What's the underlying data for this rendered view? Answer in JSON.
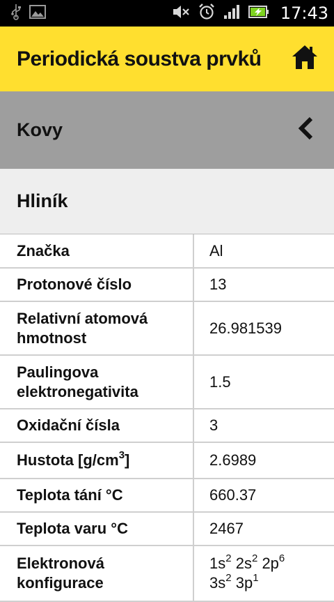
{
  "status_bar": {
    "time": "17:43",
    "icons": [
      "usb-icon",
      "gallery-icon",
      "mute-icon",
      "alarm-icon",
      "signal-icon",
      "battery-icon"
    ]
  },
  "app_bar": {
    "title": "Periodická soustva prvků",
    "home_icon": "home-icon"
  },
  "section": {
    "title": "Kovy",
    "back_icon": "chevron-left-icon"
  },
  "element": {
    "name": "Hliník"
  },
  "properties": {
    "symbol": {
      "label": "Značka",
      "value": "Al"
    },
    "proton_number": {
      "label": "Protonové číslo",
      "value": "13"
    },
    "atomic_mass": {
      "label": "Relativní atomová hmotnost",
      "value": "26.981539"
    },
    "electronegativity": {
      "label": "Paulingova elektronegativita",
      "value": "1.5"
    },
    "oxidation": {
      "label": "Oxidační čísla",
      "value": "3"
    },
    "density": {
      "label_main": "Hustota [g/cm",
      "label_sup": "3",
      "label_end": "]",
      "value": "2.6989"
    },
    "melting": {
      "label": "Teplota tání °C",
      "value": "660.37"
    },
    "boiling": {
      "label": "Teplota varu °C",
      "value": "2467"
    },
    "config": {
      "label": "Elektronová konfigurace",
      "orbitals": [
        {
          "base": "1s",
          "exp": "2"
        },
        {
          "base": "2s",
          "exp": "2"
        },
        {
          "base": "2p",
          "exp": "6"
        },
        {
          "base": "3s",
          "exp": "2"
        },
        {
          "base": "3p",
          "exp": "1"
        }
      ]
    }
  },
  "colors": {
    "app_bar": "#ffdf2f",
    "section": "#9e9e9e",
    "element_header": "#eeeeee"
  }
}
